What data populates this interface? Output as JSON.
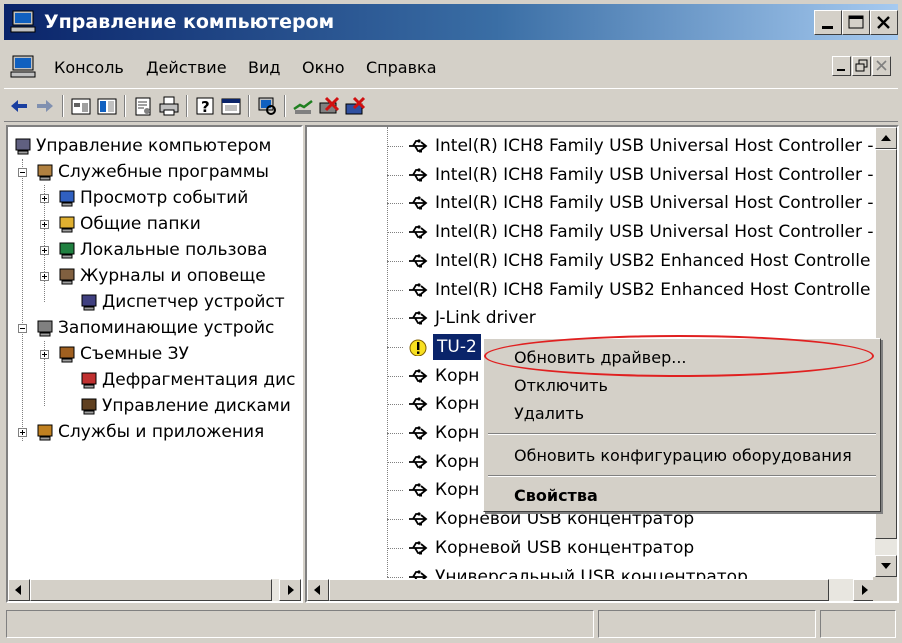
{
  "window": {
    "title": "Управление компьютером",
    "title_gradient": [
      "#0a246a",
      "#a6caf0"
    ]
  },
  "menubar": {
    "items": [
      "Консоль",
      "Действие",
      "Вид",
      "Окно",
      "Справка"
    ]
  },
  "toolbar": {
    "buttons": [
      "back-arrow-icon",
      "forward-arrow-icon",
      "up-folder-icon",
      "show-tree-icon",
      "properties-icon",
      "print-icon",
      "help-icon",
      "console-icon",
      "scan-hardware-icon",
      "update-driver-icon",
      "disable-icon",
      "uninstall-icon"
    ]
  },
  "tree": {
    "items": [
      {
        "label": "Управление компьютером",
        "icon": "computer-icon"
      },
      {
        "label": "Служебные программы",
        "icon": "tools-icon"
      },
      {
        "label": "Просмотр событий",
        "icon": "event-viewer-icon"
      },
      {
        "label": "Общие папки",
        "icon": "shared-folder-icon"
      },
      {
        "label": "Локальные пользова",
        "icon": "users-icon"
      },
      {
        "label": "Журналы и оповеще",
        "icon": "logs-icon"
      },
      {
        "label": "Диспетчер устройст",
        "icon": "device-manager-icon"
      },
      {
        "label": "Запоминающие устройс",
        "icon": "storage-icon"
      },
      {
        "label": "Съемные ЗУ",
        "icon": "removable-storage-icon"
      },
      {
        "label": "Дефрагментация дис",
        "icon": "defrag-icon"
      },
      {
        "label": "Управление дисками",
        "icon": "disk-management-icon"
      },
      {
        "label": "Службы и приложения",
        "icon": "services-icon"
      }
    ]
  },
  "devices": {
    "items": [
      "Intel(R) ICH8 Family USB Universal Host Controller -",
      "Intel(R) ICH8 Family USB Universal Host Controller -",
      "Intel(R) ICH8 Family USB Universal Host Controller -",
      "Intel(R) ICH8 Family USB Universal Host Controller -",
      "Intel(R) ICH8 Family USB2 Enhanced Host Controlle",
      "Intel(R) ICH8 Family USB2 Enhanced Host Controlle",
      "J-Link driver",
      "TU-2",
      "Корн",
      "Корн",
      "Корн",
      "Корн",
      "Корн",
      "Корневой USB концентратор",
      "Корневой USB концентратор",
      "Универсальный USB концентратор"
    ],
    "selected_index": 7,
    "warning_index": 7
  },
  "context_menu": {
    "items": [
      "Обновить драйвер...",
      "Отключить",
      "Удалить",
      "Обновить конфигурацию оборудования",
      "Свойства"
    ],
    "highlight_color": "#e02020"
  },
  "colors": {
    "face": "#d4d0c8",
    "selection": "#0a246a"
  }
}
